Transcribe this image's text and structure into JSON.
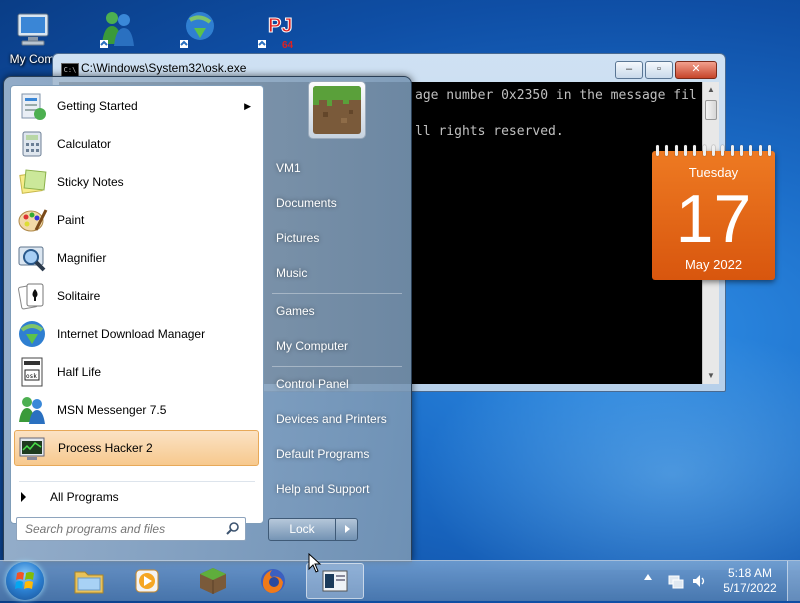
{
  "desktop": {
    "icons": [
      {
        "label": "My Com",
        "icon": "computer-icon"
      },
      {
        "label": "",
        "icon": "msn-messenger-icon"
      },
      {
        "label": "",
        "icon": "internet-download-manager-icon"
      },
      {
        "label": "",
        "icon": "pj64-icon"
      }
    ]
  },
  "console": {
    "title": "C:\\Windows\\System32\\osk.exe",
    "line1": "age number 0x2350 in the message fil",
    "line2": "ll rights reserved."
  },
  "calendar": {
    "day_name": "Tuesday",
    "date": "17",
    "month_year": "May 2022"
  },
  "start_menu": {
    "programs": [
      {
        "label": "Getting Started",
        "icon": "getting-started-icon",
        "has_submenu": true
      },
      {
        "label": "Calculator",
        "icon": "calculator-icon"
      },
      {
        "label": "Sticky Notes",
        "icon": "sticky-notes-icon"
      },
      {
        "label": "Paint",
        "icon": "paint-icon"
      },
      {
        "label": "Magnifier",
        "icon": "magnifier-icon"
      },
      {
        "label": "Solitaire",
        "icon": "solitaire-icon"
      },
      {
        "label": "Internet Download Manager",
        "icon": "internet-download-manager-icon"
      },
      {
        "label": "Half Life",
        "icon": "half-life-icon"
      },
      {
        "label": "MSN Messenger 7.5",
        "icon": "msn-messenger-icon"
      },
      {
        "label": "Process Hacker 2",
        "icon": "process-hacker-icon",
        "highlighted": true
      }
    ],
    "all_programs": "All Programs",
    "search_placeholder": "Search programs and files",
    "right_links": [
      {
        "label": "VM1"
      },
      {
        "label": "Documents"
      },
      {
        "label": "Pictures"
      },
      {
        "label": "Music"
      },
      {
        "label": "Games"
      },
      {
        "label": "My Computer"
      },
      {
        "label": "Control Panel"
      },
      {
        "label": "Devices and Printers"
      },
      {
        "label": "Default Programs"
      },
      {
        "label": "Help and Support"
      }
    ],
    "lock_label": "Lock"
  },
  "taskbar": {
    "pinned": [
      "explorer-icon",
      "media-player-icon",
      "minecraft-icon",
      "firefox-icon",
      "osk-window-icon"
    ],
    "clock_time": "5:18 AM",
    "clock_date": "5/17/2022"
  }
}
